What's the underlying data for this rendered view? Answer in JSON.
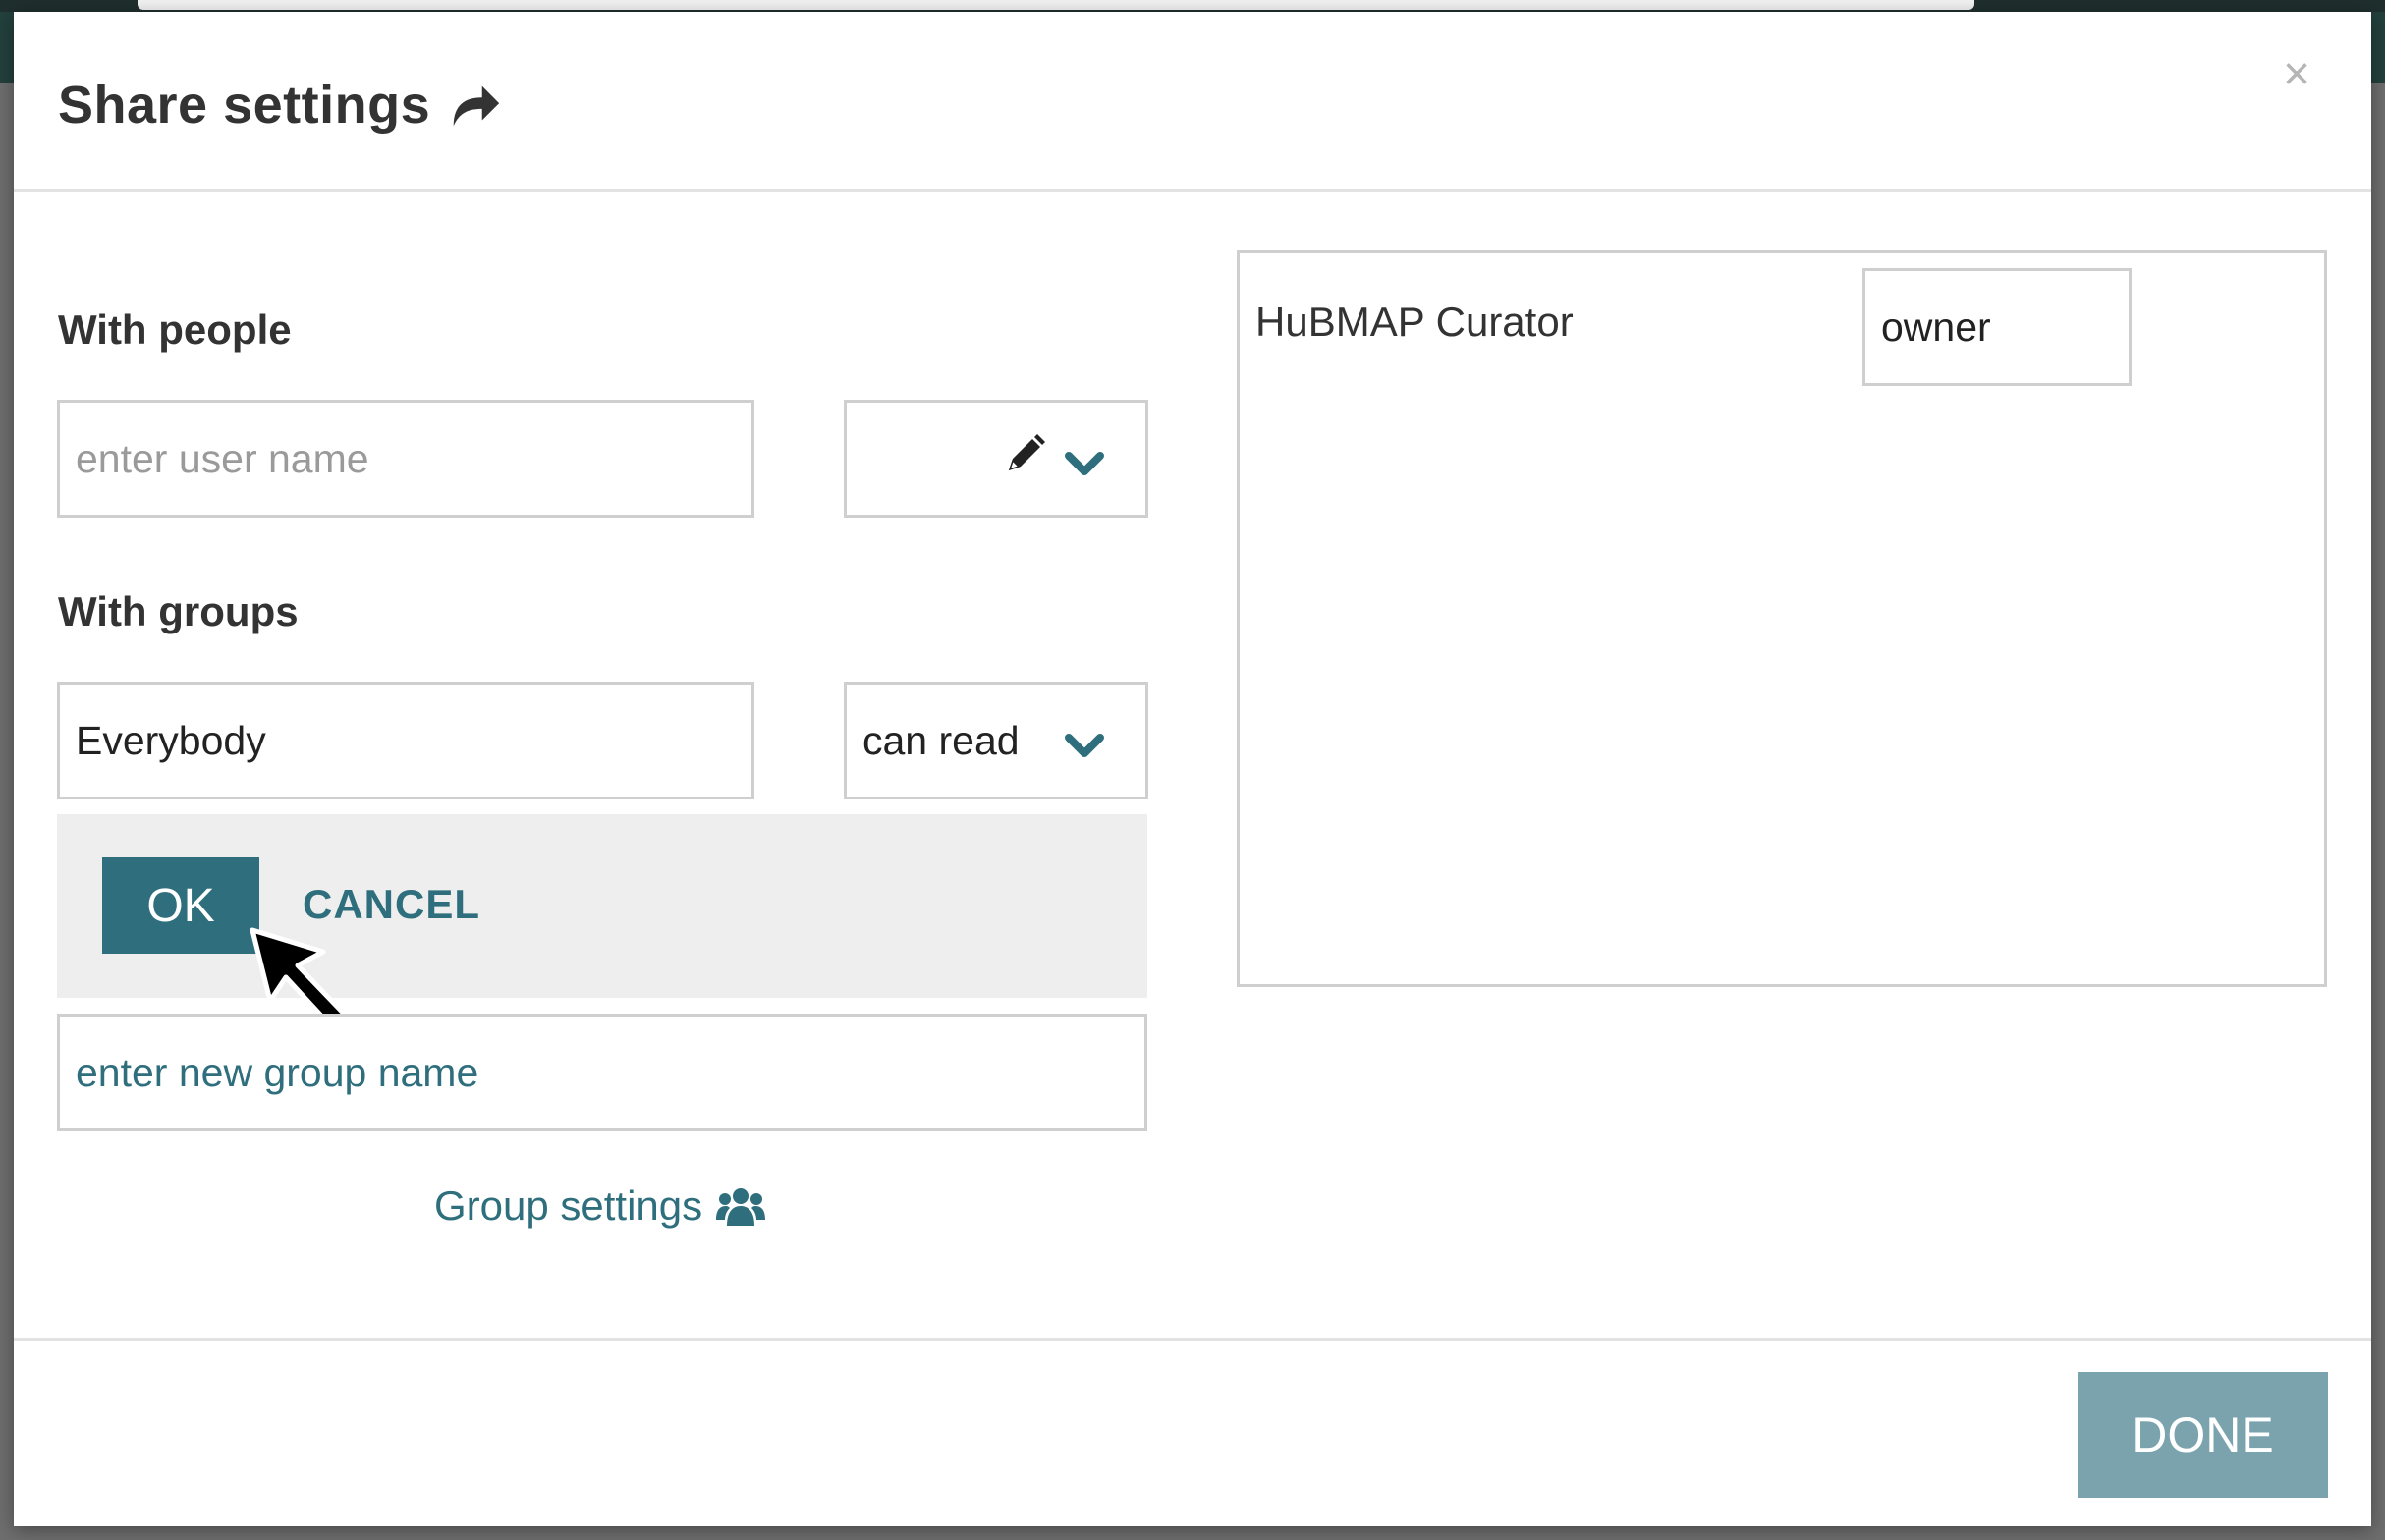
{
  "modal": {
    "title": "Share settings",
    "close_glyph": "×",
    "icons": {
      "title": "share-arrow-icon",
      "close": "close-icon"
    }
  },
  "people": {
    "label": "With people",
    "user_input_placeholder": "enter user name",
    "permission_value": "",
    "icons": [
      "pencil-icon",
      "chevron-down-icon"
    ]
  },
  "groups": {
    "label": "With groups",
    "group_value": "Everybody",
    "permission_value": "can read",
    "ok_label": "OK",
    "cancel_label": "CANCEL",
    "new_group_placeholder": "enter new group name",
    "settings_link": "Group settings",
    "settings_icon": "users-icon"
  },
  "shared_with": [
    {
      "name": "HuBMAP Curator",
      "permission": "owner"
    }
  ],
  "footer": {
    "done_label": "DONE"
  },
  "colors": {
    "accent": "#2f6f7d",
    "done_button": "#7aa3ad",
    "panel_gray": "#eeeeee",
    "border": "#cfcfcf"
  }
}
